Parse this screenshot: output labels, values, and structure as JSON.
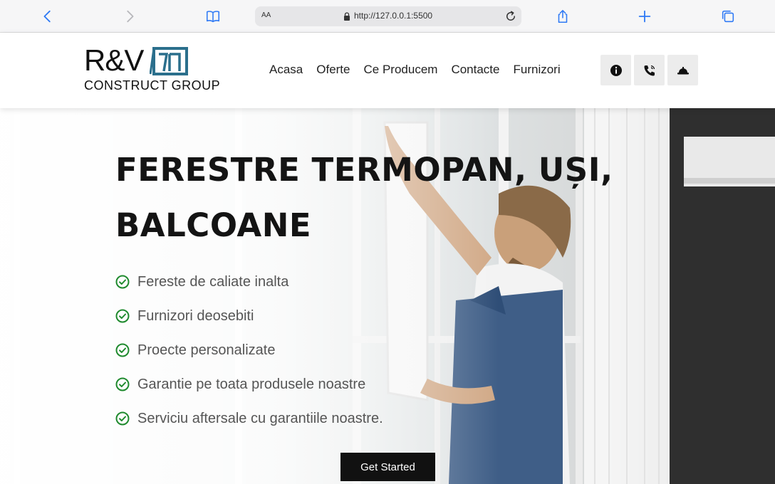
{
  "browser": {
    "text_size_label": "AA",
    "url": "http://127.0.0.1:5500"
  },
  "logo": {
    "name": "R&V",
    "subtitle": "CONSTRUCT GROUP",
    "accent_color": "#2b6f8c"
  },
  "nav": {
    "items": [
      "Acasa",
      "Oferte",
      "Ce Producem",
      "Contacte",
      "Furnizori"
    ],
    "buttons": [
      {
        "icon": "info-icon"
      },
      {
        "icon": "phone-icon"
      },
      {
        "icon": "hard-hat-icon"
      }
    ]
  },
  "hero": {
    "title": "FERESTRE TERMOPAN, UȘI, BALCOANE",
    "features": [
      "Fereste de caliate inalta",
      "Furnizori deosebiti",
      "Proecte personalizate",
      "Garantie pe toata produsele noastre",
      "Serviciu aftersale cu garantiile noastre."
    ],
    "cta_label": "Get Started",
    "check_color": "#1f8a2e"
  }
}
